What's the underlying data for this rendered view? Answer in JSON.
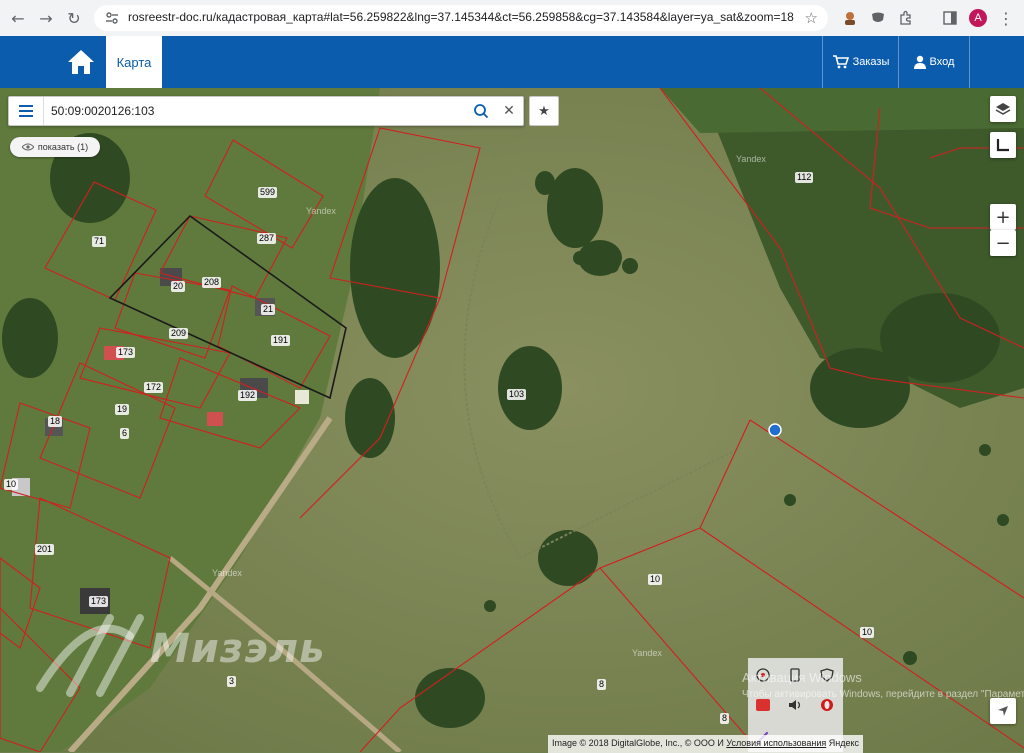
{
  "browser": {
    "url": "rosreestr-doc.ru/кадастровая_карта#lat=56.259822&lng=37.145344&ct=56.259858&cg=37.143584&layer=ya_sat&zoom=18",
    "profile_initial": "A"
  },
  "header": {
    "tab_label": "Карта",
    "orders_label": "Заказы",
    "login_label": "Вход"
  },
  "search": {
    "value": "50:09:0020126:103"
  },
  "show_button": {
    "label": "показать (1)"
  },
  "map": {
    "watermark": "Yandex",
    "plot_labels": [
      "599",
      "287",
      "71",
      "208",
      "20",
      "21",
      "191",
      "209",
      "173",
      "172",
      "192",
      "19",
      "6",
      "18",
      "10",
      "201",
      "173",
      "3",
      "103",
      "112",
      "10",
      "10",
      "8",
      "8"
    ],
    "logo_text": "Мизэль",
    "copyright_text": "Image © 2018 DigitalGlobe, Inc., © ООО И",
    "terms_label": "Условия использования",
    "yandex_label": "Яндекс"
  },
  "os_overlay": {
    "activate_title": "Активация Windows",
    "activate_sub": "Чтобы активировать Windows, перейдите в раздел \"Параметры\"."
  },
  "colors": {
    "header_blue": "#0b5cad",
    "boundary_red": "#d02020",
    "point_blue": "#1f6fd0"
  }
}
